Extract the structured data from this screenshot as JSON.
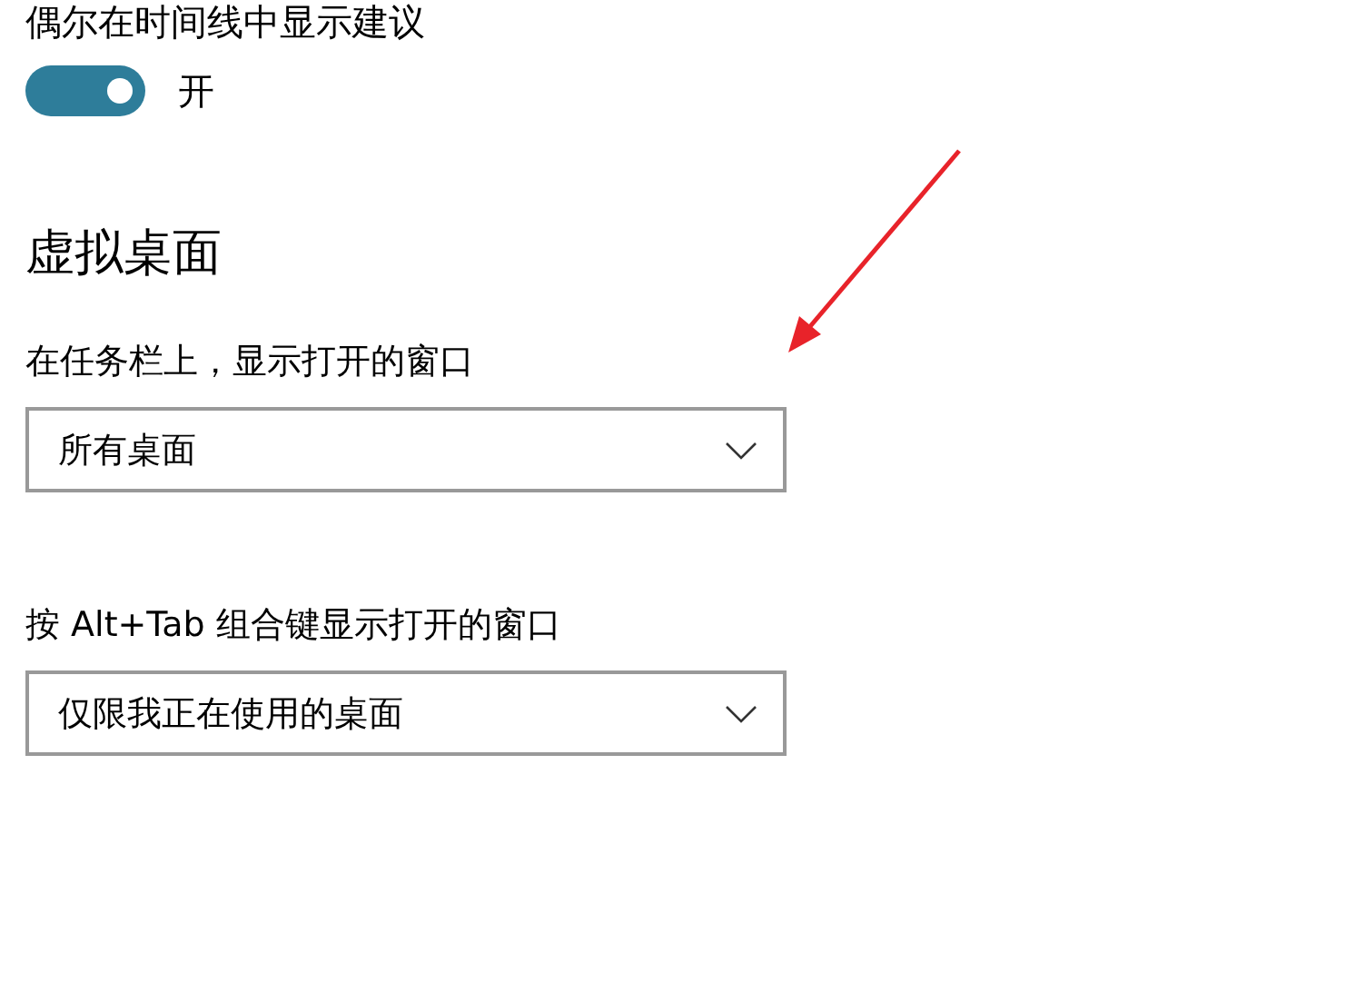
{
  "timeline": {
    "label": "偶尔在时间线中显示建议",
    "toggle": {
      "on": true,
      "state_text": "开"
    }
  },
  "section": {
    "title": "虚拟桌面",
    "settings": [
      {
        "label": "在任务栏上，显示打开的窗口",
        "value": "所有桌面"
      },
      {
        "label": "按 Alt+Tab 组合键显示打开的窗口",
        "value": "仅限我正在使用的桌面"
      }
    ]
  },
  "annotation": {
    "kind": "arrow",
    "color": "#e8232a"
  }
}
